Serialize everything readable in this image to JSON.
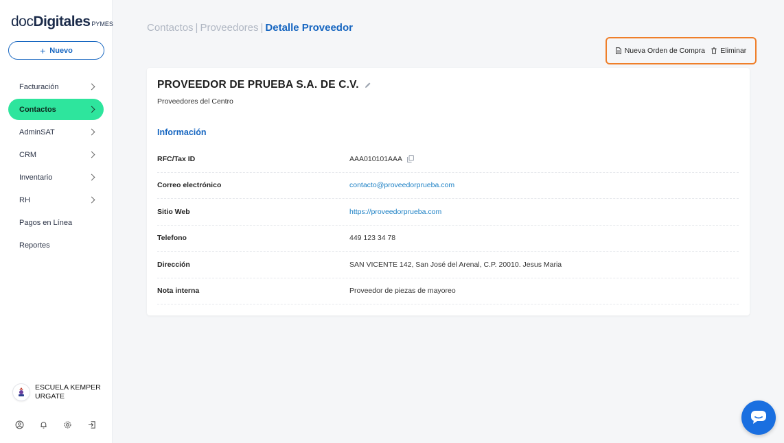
{
  "brand": {
    "logo_doc": "doc",
    "logo_digitales": "Digitales",
    "logo_pymes": "PYMES"
  },
  "sidebar": {
    "new_button": {
      "icon": "+",
      "label": "Nuevo"
    },
    "items": [
      {
        "label": "Facturación",
        "has_chevron": true,
        "active": false
      },
      {
        "label": "Contactos",
        "has_chevron": true,
        "active": true
      },
      {
        "label": "AdminSAT",
        "has_chevron": true,
        "active": false
      },
      {
        "label": "CRM",
        "has_chevron": true,
        "active": false
      },
      {
        "label": "Inventario",
        "has_chevron": true,
        "active": false
      },
      {
        "label": "RH",
        "has_chevron": true,
        "active": false
      },
      {
        "label": "Pagos en Línea",
        "has_chevron": false,
        "active": false
      },
      {
        "label": "Reportes",
        "has_chevron": false,
        "active": false
      }
    ],
    "org_name": "ESCUELA KEMPER URGATE",
    "bottom_icons": [
      "user-icon",
      "bell-icon",
      "gear-icon",
      "logout-icon"
    ]
  },
  "breadcrumb": {
    "items": [
      "Contactos",
      "Proveedores"
    ],
    "separator": "|",
    "current": "Detalle Proveedor"
  },
  "actions": {
    "new_purchase_order": "Nueva Orden de Compra",
    "delete": "Eliminar"
  },
  "provider": {
    "name": "PROVEEDOR DE PRUEBA S.A. DE C.V.",
    "group": "Proveedores del Centro",
    "section_title": "Información",
    "fields": [
      {
        "label": "RFC/Tax ID",
        "value": "AAA010101AAA",
        "type": "copy"
      },
      {
        "label": "Correo electrónico",
        "value": "contacto@proveedorprueba.com",
        "type": "link"
      },
      {
        "label": "Sitio Web",
        "value": "https://proveedorprueba.com",
        "type": "link"
      },
      {
        "label": "Telefono",
        "value": "449 123 34 78",
        "type": "text"
      },
      {
        "label": "Dirección",
        "value": "SAN VICENTE 142, San José del Arenal, C.P. 20010. Jesus Maria",
        "type": "text"
      },
      {
        "label": "Nota interna",
        "value": "Proveedor de piezas de mayoreo",
        "type": "text"
      }
    ]
  },
  "colors": {
    "accent": "#1565c0",
    "active_nav": "#2ee59d",
    "highlight_border": "#ef7f2a",
    "link": "#1a7fc4",
    "chat_button": "#1a6fe0"
  }
}
